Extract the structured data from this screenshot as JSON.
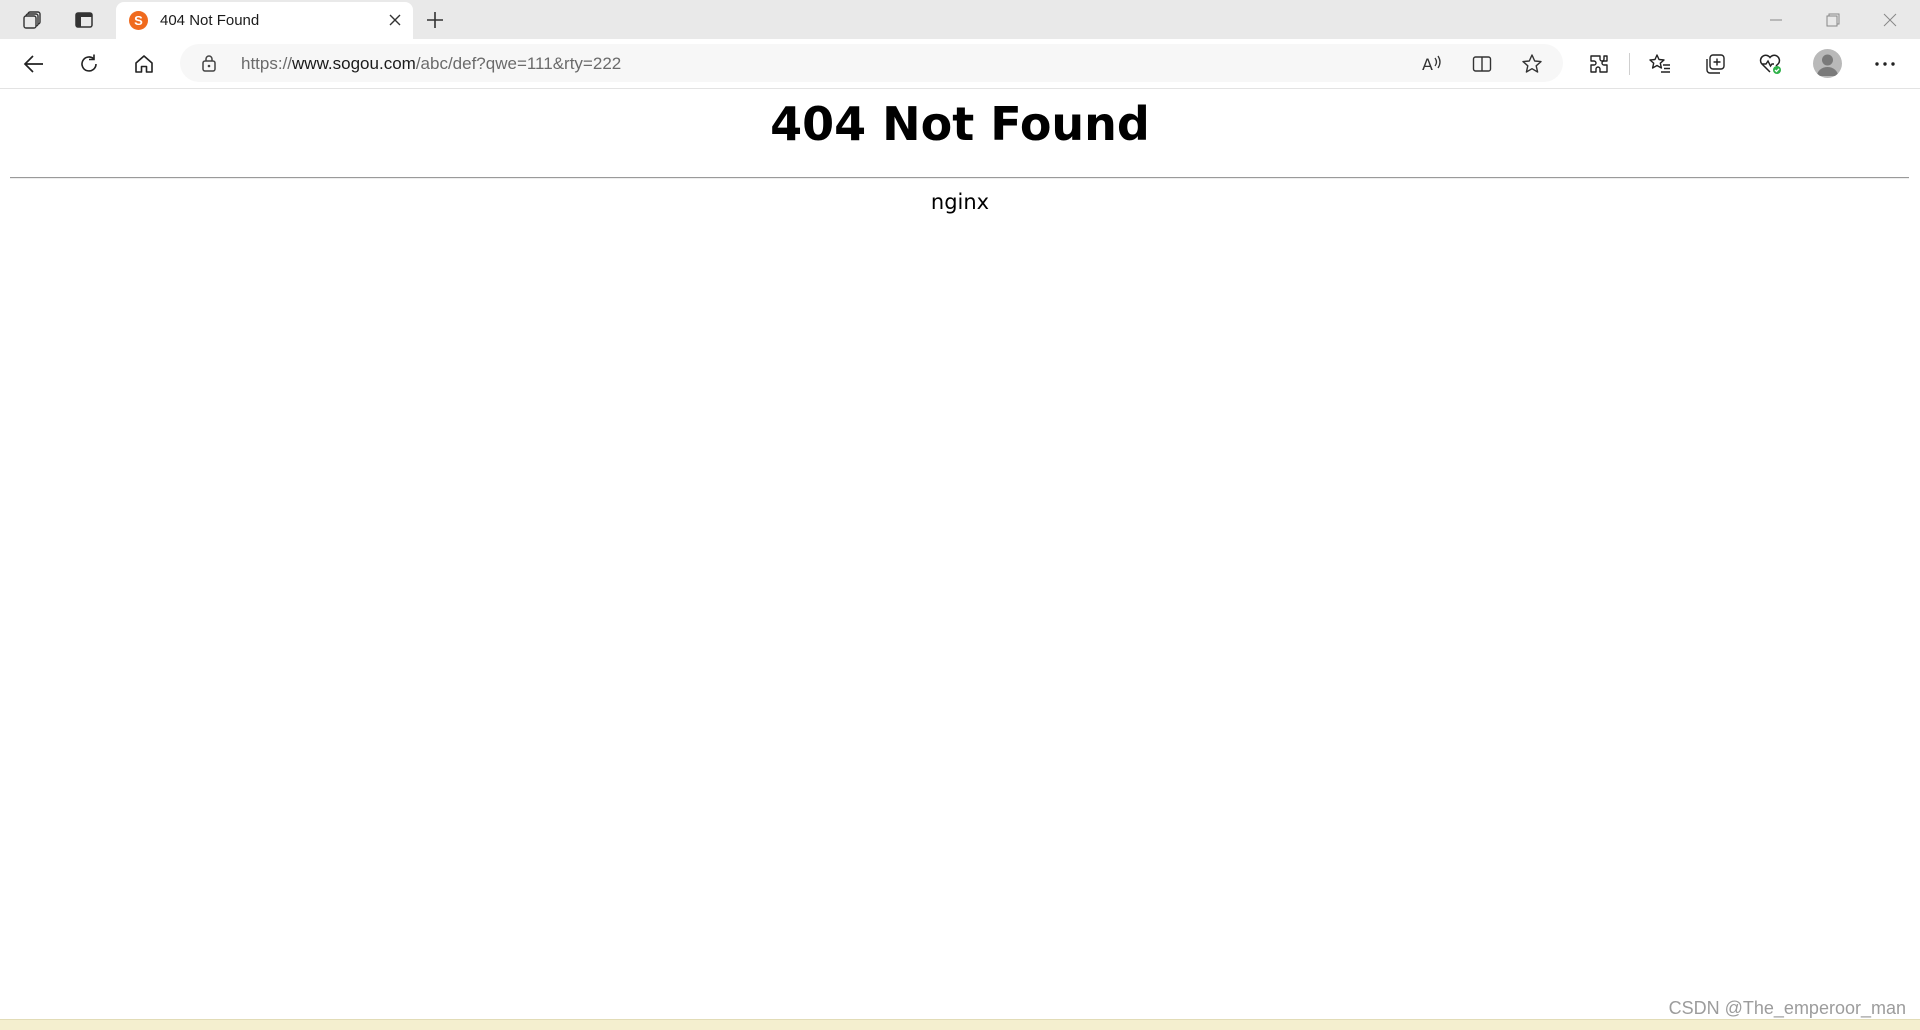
{
  "tab": {
    "favicon_letter": "S",
    "title": "404 Not Found"
  },
  "address": {
    "protocol": "https://",
    "host": "www.sogou.com",
    "path": "/abc/def?qwe=111&rty=222"
  },
  "page": {
    "heading": "404 Not Found",
    "server": "nginx"
  },
  "watermark": "CSDN @The_emperoor_man",
  "colors": {
    "favicon": "#f06a1d",
    "tabstrip": "#e9e9e9",
    "health_badge": "#2fb24a"
  },
  "icons": [
    "workspaces-icon",
    "tab-actions-icon",
    "close-icon",
    "new-tab-icon",
    "minimize-icon",
    "restore-icon",
    "back-icon",
    "refresh-icon",
    "home-icon",
    "lock-icon",
    "read-aloud-icon",
    "split-screen-icon",
    "favorite-star-icon",
    "extensions-icon",
    "favorites-icon",
    "collections-icon",
    "browser-essentials-icon",
    "profile-avatar",
    "more-icon"
  ]
}
